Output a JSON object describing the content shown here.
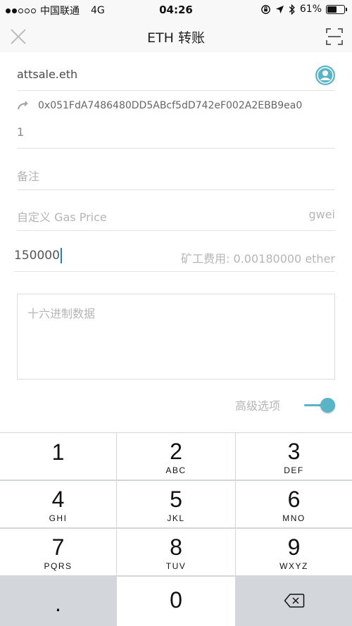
{
  "status_bar": {
    "carrier": "中国联通",
    "network": "4G",
    "time": "04:26",
    "battery_percent": "61%",
    "battery_level": 0.61
  },
  "header": {
    "title": "ETH 转账",
    "close_icon": "close-icon",
    "scan_icon": "scan-qr-icon"
  },
  "form": {
    "recipient_name": "attsale.eth",
    "resolved_address": "0x051FdA7486480DD5ABcf5dD742eF002A2EBB9ea0",
    "amount": "1",
    "memo_placeholder": "备注",
    "gas_price_placeholder": "自定义 Gas Price",
    "gas_price_unit": "gwei",
    "gas_limit": "150000",
    "miner_fee": "矿工费用: 0.00180000 ether",
    "hex_data_placeholder": "十六进制数据",
    "advanced_options_label": "高级选项",
    "advanced_options_on": true
  },
  "keypad": {
    "keys": [
      {
        "num": "1",
        "letters": ""
      },
      {
        "num": "2",
        "letters": "ABC"
      },
      {
        "num": "3",
        "letters": "DEF"
      },
      {
        "num": "4",
        "letters": "GHI"
      },
      {
        "num": "5",
        "letters": "JKL"
      },
      {
        "num": "6",
        "letters": "MNO"
      },
      {
        "num": "7",
        "letters": "PQRS"
      },
      {
        "num": "8",
        "letters": "TUV"
      },
      {
        "num": "9",
        "letters": "WXYZ"
      },
      {
        "num": ".",
        "letters": ""
      },
      {
        "num": "0",
        "letters": ""
      },
      {
        "num": "",
        "letters": ""
      }
    ]
  },
  "colors": {
    "accent": "#58b5c7",
    "keypad_bg": "#d3d6db",
    "placeholder": "#b5b5b5"
  }
}
